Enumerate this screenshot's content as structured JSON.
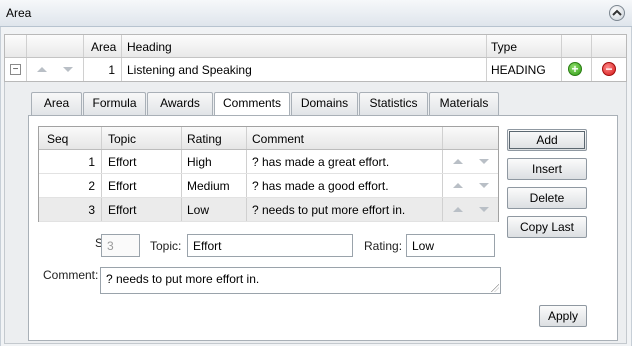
{
  "panel": {
    "title": "Area"
  },
  "area_table": {
    "headers": {
      "area": "Area",
      "heading": "Heading",
      "type": "Type"
    },
    "row": {
      "area": "1",
      "heading": "Listening and Speaking",
      "type": "HEADING"
    }
  },
  "tabs": [
    {
      "label": "Area"
    },
    {
      "label": "Formula"
    },
    {
      "label": "Awards"
    },
    {
      "label": "Comments",
      "active": true
    },
    {
      "label": "Domains"
    },
    {
      "label": "Statistics"
    },
    {
      "label": "Materials"
    }
  ],
  "comments_grid": {
    "headers": {
      "seq": "Seq",
      "topic": "Topic",
      "rating": "Rating",
      "comment": "Comment"
    },
    "rows": [
      {
        "seq": "1",
        "topic": "Effort",
        "rating": "High",
        "comment": "? has made a great effort."
      },
      {
        "seq": "2",
        "topic": "Effort",
        "rating": "Medium",
        "comment": "? has made a good effort."
      },
      {
        "seq": "3",
        "topic": "Effort",
        "rating": "Low",
        "comment": "? needs to put more effort in."
      }
    ]
  },
  "side_buttons": {
    "add": "Add",
    "insert": "Insert",
    "delete": "Delete",
    "copy_last": "Copy Last"
  },
  "form": {
    "seq_label": "Seq:",
    "seq_value": "3",
    "topic_label": "Topic:",
    "topic_value": "Effort",
    "rating_label": "Rating:",
    "rating_value": "Low",
    "comment_label": "Comment:",
    "comment_value": "? needs to put more effort in."
  },
  "apply_button": "Apply",
  "icons": {
    "collapse": "collapse-up-icon",
    "expand_row": "minus-box-icon",
    "move_up": "arrow-up-icon",
    "move_down": "arrow-down-icon",
    "add_row": "add-circle-icon",
    "remove_row": "remove-circle-icon"
  },
  "colors": {
    "add_green": "#2f9a17",
    "remove_red": "#d31313"
  }
}
